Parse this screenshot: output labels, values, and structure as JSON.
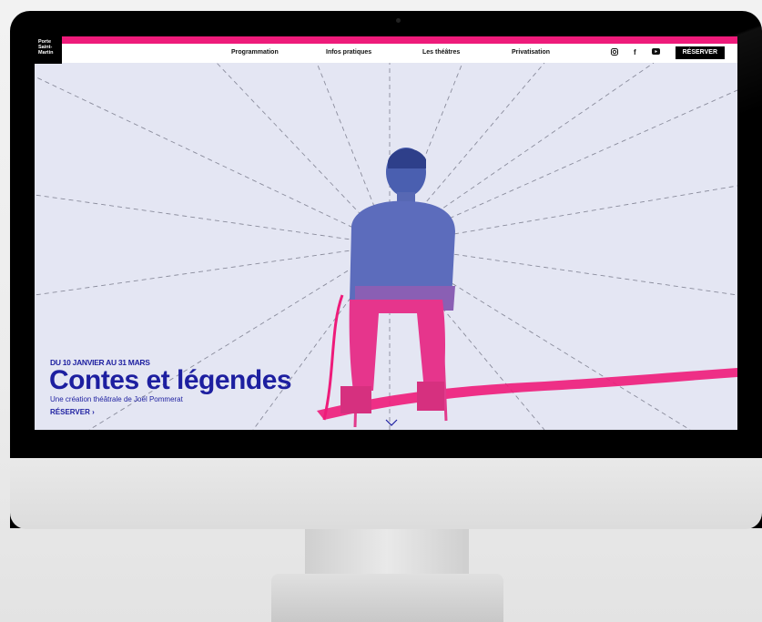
{
  "nav": {
    "logo_line1": "Porte",
    "logo_line2": "Saint-",
    "logo_line3": "Martin",
    "items": [
      "Programmation",
      "Infos pratiques",
      "Les théâtres",
      "Privatisation"
    ],
    "social_icons": [
      "instagram-icon",
      "facebook-icon",
      "youtube-icon"
    ],
    "facebook_glyph": "f",
    "reserve_label": "RÉSERVER"
  },
  "hero": {
    "date": "DU 10 JANVIER AU 31 MARS",
    "title": "Contes et légendes",
    "subtitle": "Une création théâtrale de Joël Pommerat",
    "cta": "RÉSERVER ›"
  },
  "colors": {
    "accent_pink": "#ee1b7a",
    "title_blue": "#1d1fa0",
    "screen_bg": "#e4e6f3"
  }
}
